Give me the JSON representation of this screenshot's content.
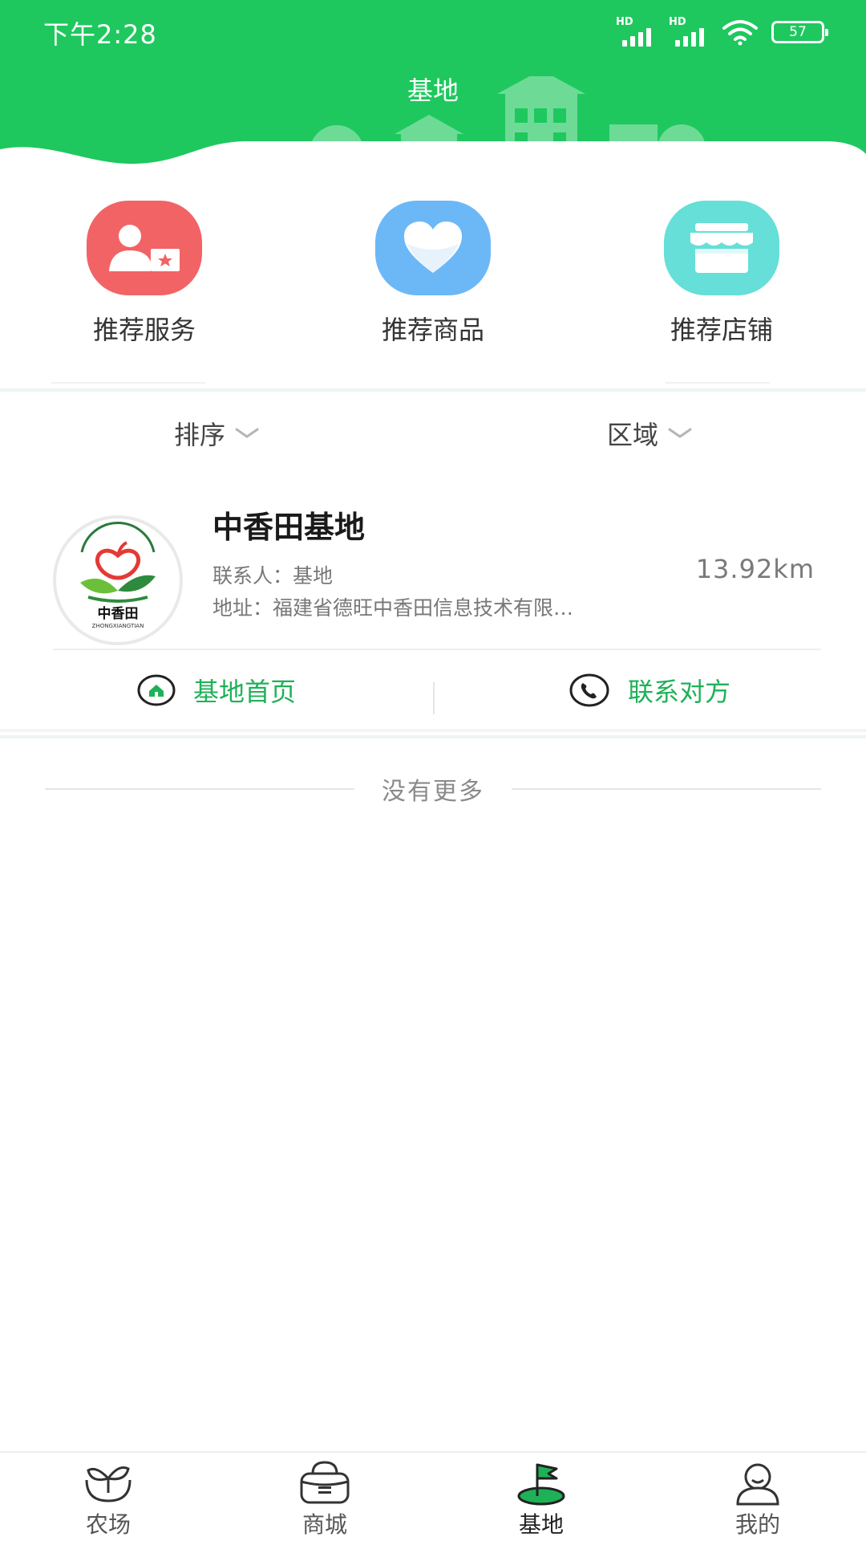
{
  "status_bar": {
    "time": "下午2:28",
    "battery": "57",
    "signal_label": "HD"
  },
  "header": {
    "title": "基地"
  },
  "quick_entries": [
    {
      "label": "推荐服务",
      "icon": "recommend-service-icon",
      "color": "#f26366"
    },
    {
      "label": "推荐商品",
      "icon": "heart-icon",
      "color": "#6cb8f7"
    },
    {
      "label": "推荐店铺",
      "icon": "store-icon",
      "color": "#65dfd8"
    }
  ],
  "filters": {
    "sort_label": "排序",
    "region_label": "区域"
  },
  "base_card": {
    "name": "中香田基地",
    "contact": "联系人：基地",
    "address": "地址：福建省德旺中香田信息技术有限…",
    "distance": "13.92km",
    "logo_text": "中香田",
    "logo_subtext": "ZHONGXIANGTIAN",
    "home_label": "基地首页",
    "contact_label": "联系对方"
  },
  "no_more": "没有更多",
  "tabbar": {
    "items": [
      {
        "label": "农场",
        "icon": "farm-sprout-icon"
      },
      {
        "label": "商城",
        "icon": "shop-basket-icon"
      },
      {
        "label": "基地",
        "icon": "base-flag-icon"
      },
      {
        "label": "我的",
        "icon": "profile-icon"
      }
    ],
    "active_index": 2
  },
  "colors": {
    "brand_green": "#1ec85e",
    "action_green": "#1fb158"
  }
}
